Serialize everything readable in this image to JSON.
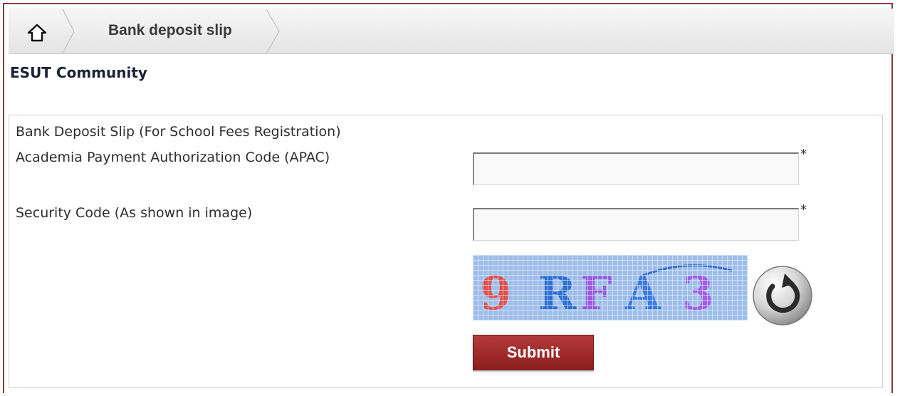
{
  "breadcrumb": {
    "home_icon": "home-icon",
    "current": "Bank deposit slip"
  },
  "community_title": "ESUT Community",
  "form": {
    "heading": "Bank Deposit Slip (For School Fees Registration)",
    "apac_label": "Academia Payment Authorization Code (APAC)",
    "apac_value": "",
    "apac_required": "*",
    "security_label": "Security Code (As shown in image)",
    "security_value": "",
    "security_required": "*",
    "captcha_text": "9RFA3",
    "refresh_icon": "refresh-icon",
    "submit_label": "Submit"
  },
  "colors": {
    "frame_border": "#8b3a3a",
    "submit_bg": "#a32b2b",
    "captcha_bg": "#a9c6ee"
  }
}
